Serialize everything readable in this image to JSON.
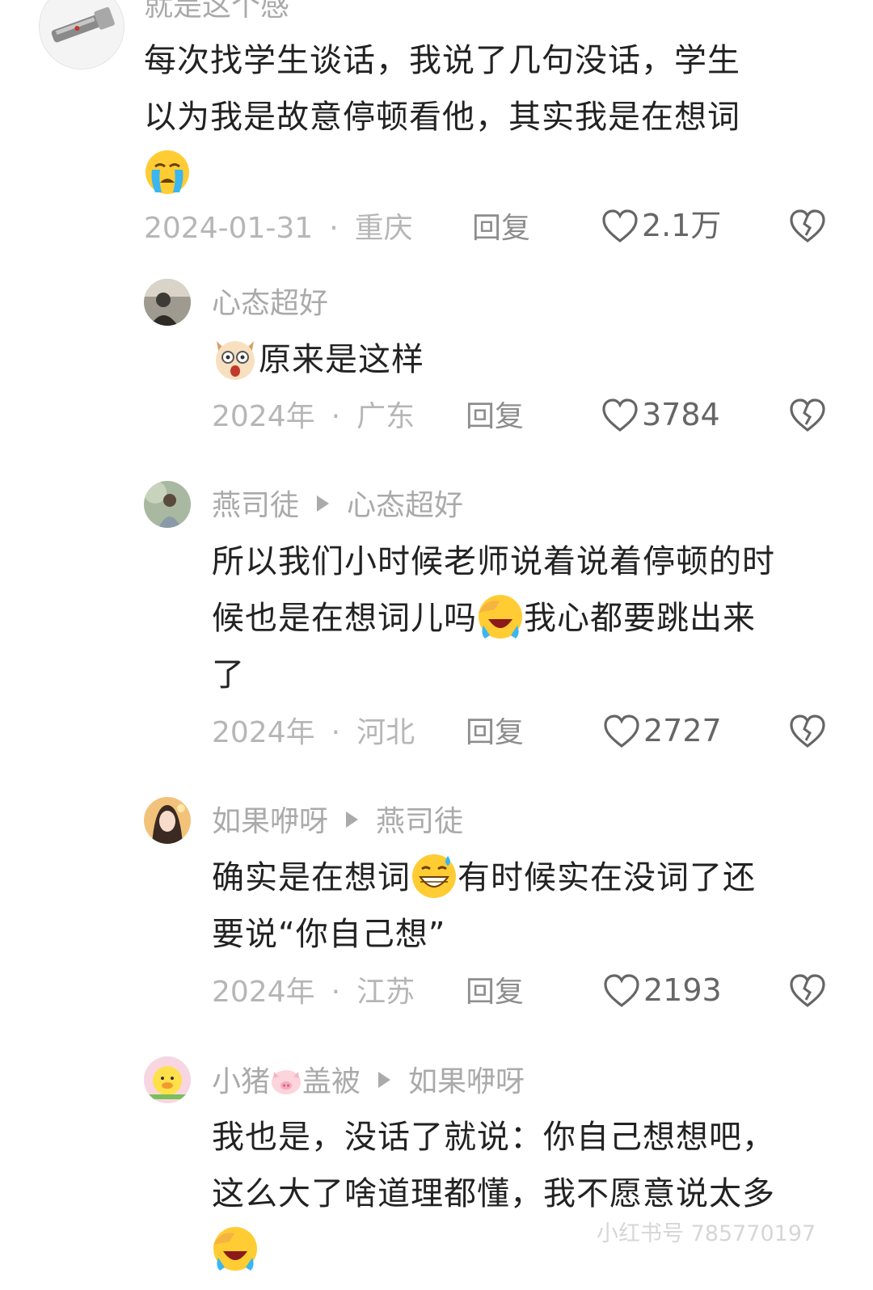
{
  "comments": [
    {
      "username": "就是这个感",
      "reply_to": "",
      "content_line1": "每次找学生谈话，我说了几句没话，学生",
      "content_line2": "以为我是故意停顿看他，其实我是在想词",
      "date": "2024-01-31",
      "location": "重庆",
      "reply_label": "回复",
      "likes": "2.1万"
    },
    {
      "username": "心态超好",
      "reply_to": "",
      "content": "原来是这样",
      "date": "2024年",
      "location": "广东",
      "reply_label": "回复",
      "likes": "3784"
    },
    {
      "username": "燕司徒",
      "reply_to": "心态超好",
      "content_line1": "所以我们小时候老师说着说着停顿的时",
      "content_line2a": "候也是在想词儿吗",
      "content_line2b": "我心都要跳出来",
      "content_line3": "了",
      "date": "2024年",
      "location": "河北",
      "reply_label": "回复",
      "likes": "2727"
    },
    {
      "username": "如果咿呀",
      "reply_to": "燕司徒",
      "content_line1a": "确实是在想词",
      "content_line1b": "有时候实在没词了还",
      "content_line2": "要说“你自己想”",
      "date": "2024年",
      "location": "江苏",
      "reply_label": "回复",
      "likes": "2193"
    },
    {
      "username_a": "小猪",
      "username_b": "盖被",
      "reply_to": "如果咿呀",
      "content_line1": "我也是，没话了就说：你自己想想吧，",
      "content_line2": "这么大了啥道理都懂，我不愿意说太多"
    }
  ],
  "separator": "·",
  "watermark": "小红书号 785770197",
  "icons": {
    "like": "heart-outline-icon",
    "dislike": "broken-heart-icon",
    "crying": "crying-face-emoji",
    "dog": "surprised-dog-emoji",
    "laughing": "facepalm-laughing-emoji",
    "sweat": "grinning-sweat-emoji",
    "pig": "pig-face-emoji"
  },
  "colors": {
    "text": "#222222",
    "username": "#aaaaaa",
    "meta": "#b6b6b6"
  }
}
